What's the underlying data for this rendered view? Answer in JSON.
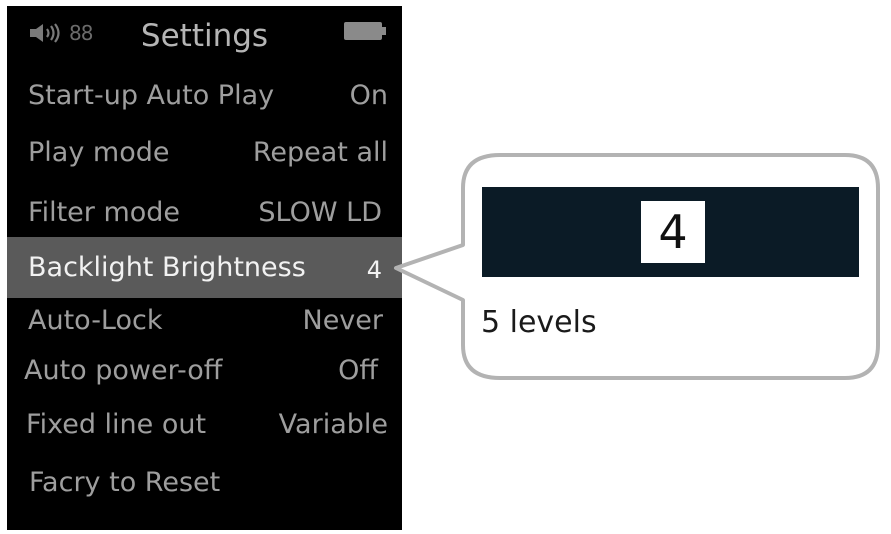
{
  "status": {
    "volume_icon": "speaker-volume-icon",
    "volume_value": "88",
    "title": "Settings",
    "battery_icon": "battery-icon"
  },
  "menu": [
    {
      "label": "Start-up Auto Play",
      "value": "On"
    },
    {
      "label": "Play mode",
      "value": "Repeat all"
    },
    {
      "label": "Filter mode",
      "value": "SLOW LD"
    },
    {
      "label": "Backlight Brightness",
      "value": "4",
      "selected": true
    },
    {
      "label": "Auto-Lock",
      "value": "Never"
    },
    {
      "label": "Auto power-off",
      "value": "Off"
    },
    {
      "label": "Fixed line out",
      "value": "Variable"
    },
    {
      "label": "Facry to Reset",
      "value": ""
    }
  ],
  "callout": {
    "preview_value": "4",
    "description": "5 levels"
  },
  "colors": {
    "screen_bg": "#000000",
    "selected_row_bg": "#5a5a5a",
    "menu_text": "#9e9e9e",
    "preview_bg": "#0b1b26",
    "callout_border": "#b3b3b3"
  }
}
